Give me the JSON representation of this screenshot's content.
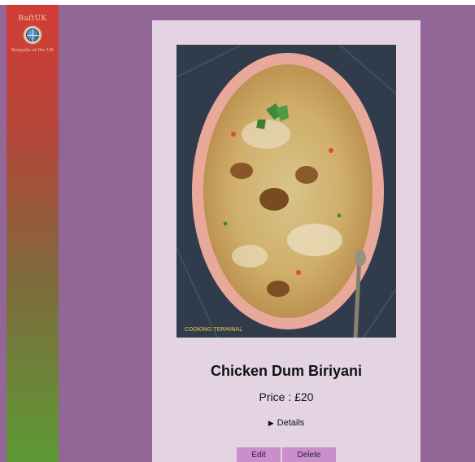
{
  "sidebar": {
    "logo_name": "BaftUK",
    "logo_tagline": "Bengalis of the UK"
  },
  "dish": {
    "title": "Chicken Dum Biriyani",
    "price": "Price : £20",
    "details_label": "Details",
    "image_watermark": "COOKING TERMINAL"
  },
  "actions": {
    "edit_label": "Edit",
    "delete_label": "Delete"
  },
  "colors": {
    "page_background": "#926696",
    "card_background": "#e3d3e3",
    "button_background": "#c98fcd",
    "sidebar_top": "#d23c36",
    "sidebar_bottom": "#5d9a35"
  }
}
